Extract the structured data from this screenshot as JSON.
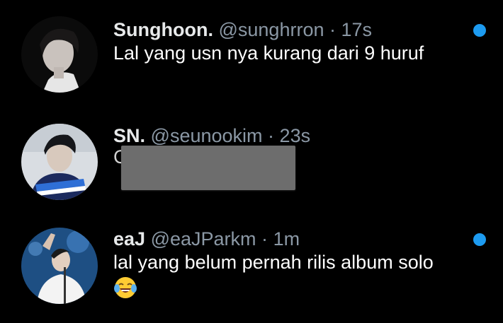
{
  "accent_color": "#1d9bf0",
  "notifications": [
    {
      "display_name": "Sunghoon.",
      "handle": "@sunghrron",
      "separator": "·",
      "time": "17s",
      "text": "Lal yang usn nya kurang dari 9 huruf",
      "unread": true,
      "avatar_icon": "avatar-sunghoon"
    },
    {
      "display_name": "SN.",
      "handle": "@seunookim",
      "separator": "·",
      "time": "23s",
      "text_fragment": "C",
      "text_redacted": true,
      "unread": false,
      "avatar_icon": "avatar-sn"
    },
    {
      "display_name": "eaJ",
      "handle": "@eaJParkm",
      "separator": "·",
      "time": "1m",
      "text": "lal yang belum pernah rilis album solo",
      "emoji_icon": "face-with-tears-of-joy-emoji",
      "unread": true,
      "avatar_icon": "avatar-eaj"
    }
  ]
}
